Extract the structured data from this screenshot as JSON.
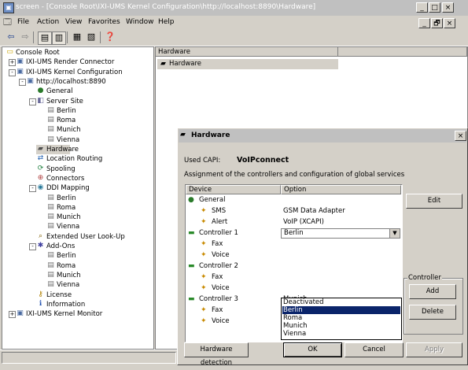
{
  "window": {
    "title": "screen - [Console Root\\IXI-UMS Kernel Configuration\\http://localhost:8890\\Hardware]",
    "buttons": [
      "_",
      "□",
      "×"
    ],
    "mdi_buttons": [
      "_",
      "🗗",
      "×"
    ]
  },
  "menubar": {
    "items": [
      "File",
      "Action",
      "View",
      "Favorites",
      "Window",
      "Help"
    ]
  },
  "toolbar": {
    "buttons": [
      "back-icon",
      "forward-icon",
      "up-folder-icon",
      "show-tree-icon",
      "properties-icon",
      "export-icon",
      "help-icon"
    ]
  },
  "tree": {
    "nodes": [
      {
        "label": "Console Root",
        "indent": 0,
        "icon": "folder-icon"
      },
      {
        "label": "IXI-UMS Render Connector",
        "indent": 1,
        "icon": "computer-icon",
        "expander": "+"
      },
      {
        "label": "IXI-UMS Kernel Configuration",
        "indent": 1,
        "icon": "computer-icon",
        "expander": "-"
      },
      {
        "label": "http://localhost:8890",
        "indent": 2,
        "icon": "computer-icon",
        "expander": "-"
      },
      {
        "label": "General",
        "indent": 3,
        "icon": "globe-icon"
      },
      {
        "label": "Server Site",
        "indent": 3,
        "icon": "site-icon",
        "expander": "-"
      },
      {
        "label": "Berlin",
        "indent": 4,
        "icon": "server-icon"
      },
      {
        "label": "Roma",
        "indent": 4,
        "icon": "server-icon"
      },
      {
        "label": "Munich",
        "indent": 4,
        "icon": "server-icon"
      },
      {
        "label": "Vienna",
        "indent": 4,
        "icon": "server-icon"
      },
      {
        "label": "Hardware",
        "indent": 3,
        "icon": "hardware-icon",
        "selected": true
      },
      {
        "label": "Location Routing",
        "indent": 3,
        "icon": "routing-icon"
      },
      {
        "label": "Spooling",
        "indent": 3,
        "icon": "spooling-icon"
      },
      {
        "label": "Connectors",
        "indent": 3,
        "icon": "connectors-icon"
      },
      {
        "label": "DDI Mapping",
        "indent": 3,
        "icon": "ddi-icon",
        "expander": "-"
      },
      {
        "label": "Berlin",
        "indent": 4,
        "icon": "server-icon"
      },
      {
        "label": "Roma",
        "indent": 4,
        "icon": "server-icon"
      },
      {
        "label": "Munich",
        "indent": 4,
        "icon": "server-icon"
      },
      {
        "label": "Vienna",
        "indent": 4,
        "icon": "server-icon"
      },
      {
        "label": "Extended User Look-Up",
        "indent": 3,
        "icon": "lookup-icon"
      },
      {
        "label": "Add-Ons",
        "indent": 3,
        "icon": "addons-icon",
        "expander": "-"
      },
      {
        "label": "Berlin",
        "indent": 4,
        "icon": "server-icon"
      },
      {
        "label": "Roma",
        "indent": 4,
        "icon": "server-icon"
      },
      {
        "label": "Munich",
        "indent": 4,
        "icon": "server-icon"
      },
      {
        "label": "Vienna",
        "indent": 4,
        "icon": "server-icon"
      },
      {
        "label": "License",
        "indent": 3,
        "icon": "key-icon"
      },
      {
        "label": "Information",
        "indent": 3,
        "icon": "info-icon"
      },
      {
        "label": "IXI-UMS Kernel Monitor",
        "indent": 1,
        "icon": "computer-icon",
        "expander": "+"
      }
    ]
  },
  "rightpane": {
    "column_header": "Hardware",
    "item_label": "Hardware"
  },
  "dialog": {
    "title": "Hardware",
    "used_capi_label": "Used CAPI:",
    "used_capi_value": "VoIPconnect",
    "description": "Assignment of the controllers and configuration of global services",
    "grid": {
      "columns": [
        "Device",
        "Option"
      ],
      "rows": [
        {
          "device": "General",
          "option": "",
          "level": 0,
          "icon": "globe-icon"
        },
        {
          "device": "SMS",
          "option": "GSM Data Adapter",
          "level": 1,
          "icon": "service-icon"
        },
        {
          "device": "Alert",
          "option": "VoIP (XCAPI)",
          "level": 1,
          "icon": "service-icon"
        },
        {
          "device": "Controller 1",
          "option": "Berlin",
          "level": 0,
          "icon": "controller-icon",
          "dropdown": true
        },
        {
          "device": "Fax",
          "option": "",
          "level": 1,
          "icon": "service-icon"
        },
        {
          "device": "Voice",
          "option": "",
          "level": 1,
          "icon": "service-icon"
        },
        {
          "device": "Controller 2",
          "option": "",
          "level": 0,
          "icon": "controller-icon"
        },
        {
          "device": "Fax",
          "option": "",
          "level": 1,
          "icon": "service-icon"
        },
        {
          "device": "Voice",
          "option": "",
          "level": 1,
          "icon": "service-icon"
        },
        {
          "device": "Controller 3",
          "option": "Munich",
          "level": 0,
          "icon": "controller-icon"
        },
        {
          "device": "Fax",
          "option": "",
          "level": 1,
          "icon": "service-icon"
        },
        {
          "device": "Voice",
          "option": "",
          "level": 1,
          "icon": "service-icon"
        }
      ]
    },
    "dropdown_options": [
      "Deactivated",
      "Berlin",
      "Roma",
      "Munich",
      "Vienna"
    ],
    "dropdown_selected": "Berlin",
    "edit_button": "Edit",
    "controller_group_label": "Controller",
    "add_button": "Add",
    "delete_button": "Delete",
    "hardware_detection_button": "Hardware detection",
    "ok_button": "OK",
    "cancel_button": "Cancel",
    "apply_button": "Apply"
  },
  "colors": {
    "face": "#d4d0c8",
    "selection": "#0a246a",
    "inactive_title": "#c0c0c0"
  }
}
